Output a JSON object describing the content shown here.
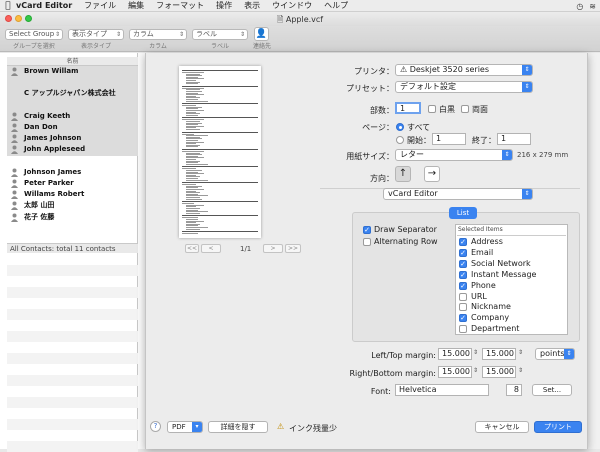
{
  "menubar": {
    "app_name": "vCard Editor",
    "items": [
      "ファイル",
      "編集",
      "フォーマット",
      "操作",
      "表示",
      "ウインドウ",
      "ヘルプ"
    ]
  },
  "window": {
    "title": "Apple.vcf"
  },
  "toolbar": {
    "group_select": "Select Group",
    "group_caption": "グループを選択",
    "display_type": "表示タイプ",
    "display_type_caption": "表示タイプ",
    "column_select": "カラム",
    "column_caption": "カラム",
    "label_select": "ラベル",
    "label_caption": "ラベル",
    "contact_caption": "連絡先"
  },
  "list": {
    "header": "名前",
    "rows": [
      {
        "name": "Brown Willam",
        "shaded": true,
        "icon": true
      },
      {
        "name": "",
        "shaded": true,
        "icon": false
      },
      {
        "name": "C アップルジャパン株式会社",
        "shaded": true,
        "icon": false
      },
      {
        "name": "",
        "shaded": true,
        "icon": false
      },
      {
        "name": "Craig Keeth",
        "shaded": true,
        "icon": true
      },
      {
        "name": "Dan Don",
        "shaded": true,
        "icon": true
      },
      {
        "name": "James Johnson",
        "shaded": true,
        "icon": true
      },
      {
        "name": "John Appleseed",
        "shaded": true,
        "icon": true
      },
      {
        "name": "",
        "shaded": false,
        "icon": false
      },
      {
        "name": "Johnson James",
        "shaded": false,
        "icon": true
      },
      {
        "name": "Peter Parker",
        "shaded": false,
        "icon": true
      },
      {
        "name": "Willams Robert",
        "shaded": false,
        "icon": true
      },
      {
        "name": "太郎 山田",
        "shaded": false,
        "icon": true
      },
      {
        "name": "花子 佐藤",
        "shaded": false,
        "icon": true
      }
    ],
    "footer": "All Contacts: total 11 contacts"
  },
  "preview": {
    "first_btn": "<<",
    "prev_btn": "<",
    "next_btn": ">",
    "last_btn": ">>",
    "page_count": "1/1"
  },
  "print": {
    "printer_label": "プリンタ：",
    "printer_value": "Deskjet 3520 series",
    "preset_label": "プリセット：",
    "preset_value": "デフォルト設定",
    "copies_label": "部数：",
    "copies_value": "1",
    "bw_label": "白黒",
    "duplex_label": "両面",
    "pages_label": "ページ：",
    "all_label": "すべて",
    "from_label": "開始：",
    "from_value": "1",
    "to_label": "終了：",
    "to_value": "1",
    "paper_label": "用紙サイズ：",
    "paper_value": "レター",
    "paper_dims": "216 x 279 mm",
    "orientation_label": "方向：",
    "section_value": "vCard Editor",
    "list_tab": "List",
    "draw_separator": "Draw Separator",
    "alternating_row": "Alternating Row",
    "selected_items_header": "Selected Items",
    "items": [
      {
        "label": "Address",
        "checked": true
      },
      {
        "label": "Email",
        "checked": true
      },
      {
        "label": "Social Network",
        "checked": true
      },
      {
        "label": "Instant Message",
        "checked": true
      },
      {
        "label": "Phone",
        "checked": true
      },
      {
        "label": "URL",
        "checked": false
      },
      {
        "label": "Nickname",
        "checked": false
      },
      {
        "label": "Company",
        "checked": true
      },
      {
        "label": "Department",
        "checked": false
      }
    ],
    "lefttop_label": "Left/Top margin:",
    "lefttop_value1": "15.000",
    "lefttop_value2": "15.000",
    "units_value": "points",
    "rightbottom_label": "Right/Bottom margin:",
    "rightbottom_value1": "15.000",
    "rightbottom_value2": "15.000",
    "font_label": "Font:",
    "font_value": "Helvetica",
    "font_size": "8",
    "set_button": "Set...",
    "help": "?",
    "pdf_button": "PDF",
    "hide_details": "詳細を隠す",
    "ink_warning": "インク残量少",
    "cancel": "キャンセル",
    "print": "プリント"
  },
  "colors": {
    "accent": "#3a83f0"
  }
}
